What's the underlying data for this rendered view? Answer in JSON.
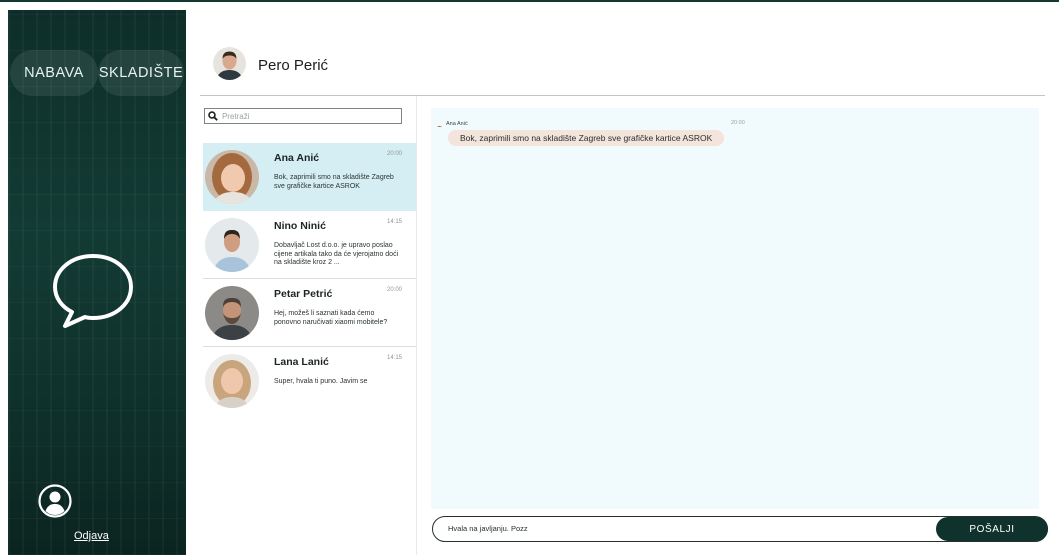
{
  "sidebar": {
    "nav": [
      {
        "label": "NABAVA"
      },
      {
        "label": "SKLADIŠTE"
      }
    ],
    "chat_icon": "chat-bubble-icon",
    "user_icon": "user-circle-icon",
    "logout_label": "Odjava"
  },
  "header": {
    "contact_name": "Pero Perić"
  },
  "search": {
    "placeholder": "Pretraži",
    "icon": "search-icon"
  },
  "conversations": [
    {
      "name": "Ana Anić",
      "time": "20:00",
      "message": "Bok, zaprimili smo na skladište Zagreb sve grafičke kartice ASROK",
      "active": true
    },
    {
      "name": "Nino Ninić",
      "time": "14:15",
      "message": "Dobavljač Lost d.o.o. je upravo poslao cijene artikala tako da će vjerojatno doći na skladište kroz 2 ...",
      "active": false
    },
    {
      "name": "Petar Petrić",
      "time": "20:00",
      "message": "Hej, možeš li saznati kada ćemo ponovno naručivati xiaomi mobitele?",
      "active": false
    },
    {
      "name": "Lana Lanić",
      "time": "14:15",
      "message": "Super, hvala ti puno. Javim se",
      "active": false
    }
  ],
  "chat": {
    "messages": [
      {
        "sender": "Ana Anić",
        "time": "20:00",
        "text": "Bok, zaprimili smo na skladište Zagreb sve grafičke kartice ASROK"
      }
    ]
  },
  "composer": {
    "value": "Hvala na javljanju. Pozz",
    "send_label": "POŠALJI"
  },
  "colors": {
    "sidebar": "#0f302a",
    "active_conversation": "#d5eef3",
    "chat_background": "#f1fafc",
    "message_bubble": "#f3e4dc",
    "send_button": "#0f322c"
  }
}
